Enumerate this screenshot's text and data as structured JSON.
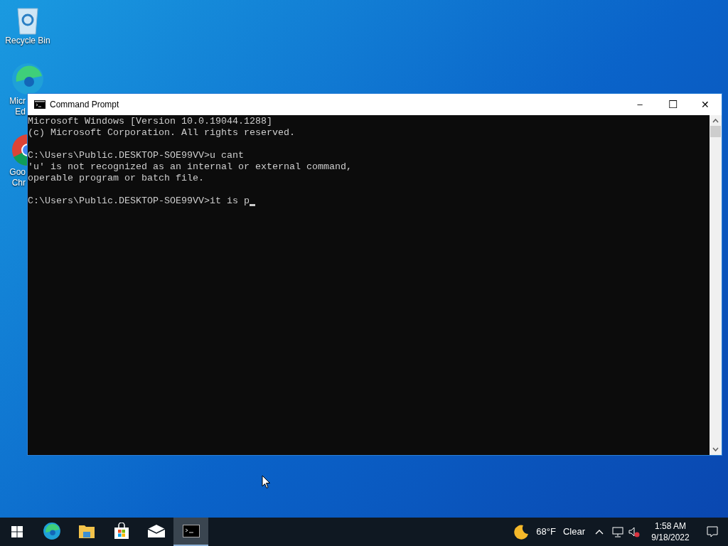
{
  "desktop_icons": [
    {
      "kind": "recycle",
      "lines": [
        "Recycle Bin"
      ]
    },
    {
      "kind": "edge",
      "lines": [
        "Micr",
        "Ed"
      ]
    },
    {
      "kind": "chrome",
      "lines": [
        "Goo",
        "Chr"
      ]
    }
  ],
  "window": {
    "title": "Command Prompt",
    "minimize": "–",
    "maximize": "☐",
    "close": "✕",
    "console_blocks": [
      [
        "Microsoft Windows [Version 10.0.19044.1288]",
        "(c) Microsoft Corporation. All rights reserved."
      ],
      [
        "C:\\Users\\Public.DESKTOP-SOE99VV>u cant",
        "'u' is not recognized as an internal or external command,",
        "operable program or batch file."
      ],
      [
        "C:\\Users\\Public.DESKTOP-SOE99VV>it is p"
      ]
    ]
  },
  "taskbar": {
    "apps": [
      {
        "kind": "edge",
        "selected": false
      },
      {
        "kind": "explorer",
        "selected": false
      },
      {
        "kind": "store",
        "selected": false
      },
      {
        "kind": "mail",
        "selected": false
      },
      {
        "kind": "cmd",
        "selected": true
      }
    ],
    "weather": {
      "temperature": "68°F",
      "condition": "Clear"
    },
    "time": "1:58 AM",
    "date": "9/18/2022"
  }
}
